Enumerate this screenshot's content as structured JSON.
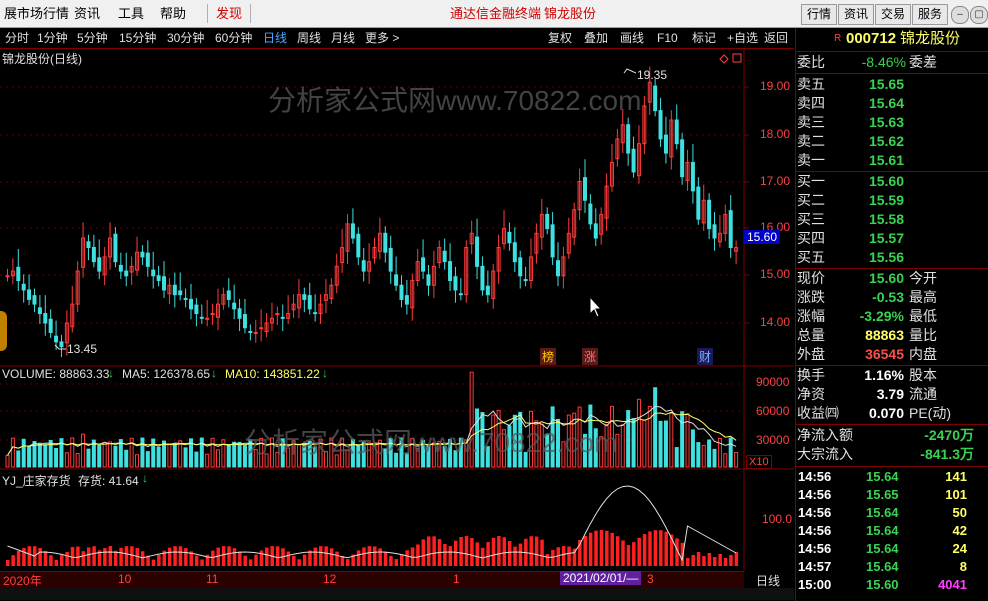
{
  "menubar": {
    "items": [
      "展市场行情",
      "资讯",
      "工具",
      "帮助"
    ],
    "discover": "发现",
    "center": [
      "通达信金融终端",
      "锦龙股份"
    ],
    "right_buttons": [
      "行情",
      "资讯",
      "交易",
      "服务"
    ]
  },
  "periods": {
    "items": [
      "分时",
      "1分钟",
      "5分钟",
      "15分钟",
      "30分钟",
      "60分钟",
      "日线",
      "周线",
      "月线",
      "更多 >"
    ],
    "active": "日线"
  },
  "toolbar": [
    "复权",
    "叠加",
    "画线",
    "F10",
    "标记",
    "+自选",
    "返回"
  ],
  "chart": {
    "title": "锦龙股份(日线)",
    "watermark": "分析家公式网www.70822.com",
    "price_ticks": [
      "19.00",
      "18.00",
      "17.00",
      "16.00",
      "15.00",
      "14.00"
    ],
    "high_label": "19.35",
    "low_label": "13.45",
    "current_price": "15.60",
    "event_markers": [
      "榜",
      "涨",
      "财"
    ],
    "volume_header": {
      "volume": "VOLUME: 88863.33",
      "ma5": "MA5: 126378.65",
      "ma10": "MA10: 143851.22"
    },
    "volume_ticks": [
      "90000",
      "60000",
      "30000"
    ],
    "volume_unit": "X10",
    "indicator_header": {
      "name": "YJ_庄家存货",
      "value": "存货: 41.64"
    },
    "indicator_tick": "100.0",
    "date_axis": [
      "2020年",
      "10",
      "11",
      "12",
      "1",
      "2021/02/01/—",
      "3"
    ],
    "period_label": "日线"
  },
  "quote": {
    "code": "000712",
    "name": "锦龙股份",
    "weibi_label": "委比",
    "weibi_value": "-8.46%",
    "weicha_label": "委差",
    "sell": [
      {
        "label": "卖五",
        "price": "15.65"
      },
      {
        "label": "卖四",
        "price": "15.64"
      },
      {
        "label": "卖三",
        "price": "15.63"
      },
      {
        "label": "卖二",
        "price": "15.62"
      },
      {
        "label": "卖一",
        "price": "15.61"
      }
    ],
    "buy": [
      {
        "label": "买一",
        "price": "15.60"
      },
      {
        "label": "买二",
        "price": "15.59"
      },
      {
        "label": "买三",
        "price": "15.58"
      },
      {
        "label": "买四",
        "price": "15.57"
      },
      {
        "label": "买五",
        "price": "15.56"
      }
    ],
    "stats": [
      {
        "label": "现价",
        "value": "15.60",
        "label2": "今开"
      },
      {
        "label": "涨跌",
        "value": "-0.53",
        "label2": "最高"
      },
      {
        "label": "涨幅",
        "value": "-3.29%",
        "label2": "最低"
      },
      {
        "label": "总量",
        "value": "88863",
        "label2": "量比"
      },
      {
        "label": "外盘",
        "value": "36545",
        "label2": "内盘"
      }
    ],
    "stats2": [
      {
        "label": "换手",
        "value": "1.16%",
        "label2": "股本"
      },
      {
        "label": "净资",
        "value": "3.79",
        "label2": "流通"
      },
      {
        "label": "收益㈣",
        "value": "0.070",
        "label2": "PE(动)"
      }
    ],
    "flows": [
      {
        "label": "净流入额",
        "value": "-2470万"
      },
      {
        "label": "大宗流入",
        "value": "-841.3万"
      }
    ],
    "ticks": [
      {
        "time": "14:56",
        "price": "15.64",
        "vol": "141"
      },
      {
        "time": "14:56",
        "price": "15.65",
        "vol": "101"
      },
      {
        "time": "14:56",
        "price": "15.64",
        "vol": "50"
      },
      {
        "time": "14:56",
        "price": "15.64",
        "vol": "42"
      },
      {
        "time": "14:56",
        "price": "15.64",
        "vol": "24"
      },
      {
        "time": "14:57",
        "price": "15.64",
        "vol": "8"
      },
      {
        "time": "15:00",
        "price": "15.60",
        "vol": "4041"
      }
    ]
  },
  "colors": {
    "up": "#ff3b3b",
    "down": "#3fe0e0",
    "axis": "#800000",
    "active": "#4da6ff"
  }
}
